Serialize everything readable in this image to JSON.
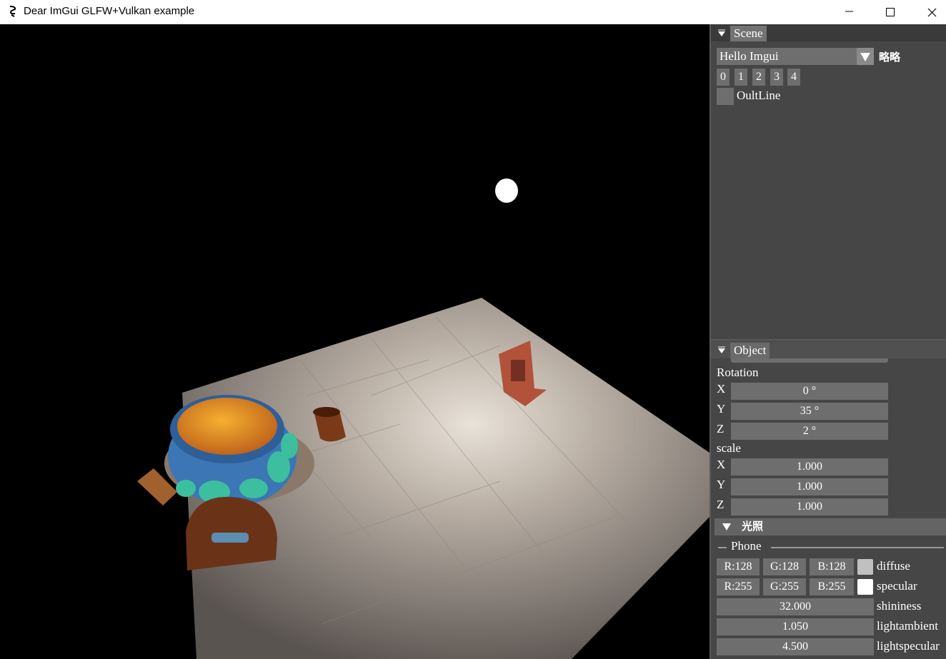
{
  "window": {
    "title": "Dear ImGui GLFW+Vulkan example",
    "controls": [
      "minimize",
      "maximize",
      "close"
    ]
  },
  "scene_panel": {
    "tab": "Scene",
    "combo_value": "Hello Imgui",
    "combo_side_label": "略略",
    "index_buttons": [
      "0",
      "1",
      "2",
      "3",
      "4"
    ],
    "outline_label": "OultLine",
    "outline_checked": false
  },
  "object_panel": {
    "tab": "Object",
    "rotation": {
      "label": "Rotation",
      "x_label": "X",
      "x_value": "0 °",
      "y_label": "Y",
      "y_value": "35 °",
      "z_label": "Z",
      "z_value": "2 °"
    },
    "scale": {
      "label": "scale",
      "x_label": "X",
      "x_value": "1.000",
      "y_label": "Y",
      "y_value": "1.000",
      "z_label": "Z",
      "z_value": "1.000"
    },
    "light_header": "光照",
    "phone_separator": "Phone",
    "diffuse": {
      "r": "R:128",
      "g": "G:128",
      "b": "B:128",
      "label": "diffuse",
      "color": "#c0c0c0"
    },
    "specular": {
      "r": "R:255",
      "g": "G:255",
      "b": "B:255",
      "label": "specular",
      "color": "#ffffff"
    },
    "shininess": {
      "value": "32.000",
      "label": "shininess"
    },
    "lightambient": {
      "value": "1.050",
      "label": "lightambient"
    },
    "lightspecular": {
      "value": "4.500",
      "label": "lightspecular"
    }
  },
  "colors": {
    "panel_bg": "#464646",
    "frame_bg": "#6e6e6e",
    "viewport_bg": "#000000"
  }
}
